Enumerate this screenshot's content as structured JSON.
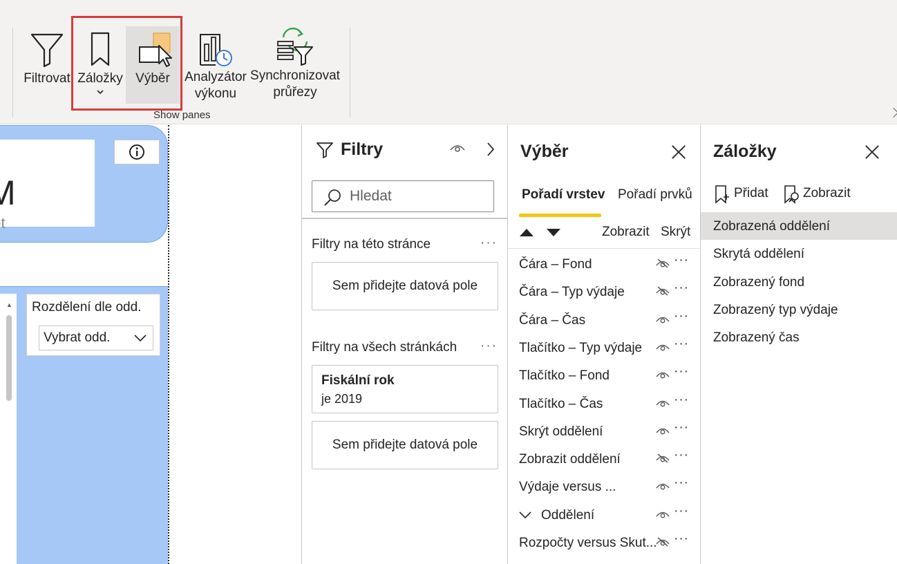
{
  "ribbon": {
    "buttons": [
      {
        "id": "filter",
        "label": "Filtrovat",
        "icon": "funnel-icon"
      },
      {
        "id": "bookmarks",
        "label": "Záložky",
        "icon": "bookmark-icon",
        "has_dropdown": true
      },
      {
        "id": "selection",
        "label": "Výběr",
        "icon": "selection-cursor-icon",
        "selected": true
      },
      {
        "id": "perf",
        "label_line1": "Analyzátor",
        "label_line2": "výkonu",
        "icon": "performance-analyzer-icon"
      },
      {
        "id": "sync",
        "label_line1": "Synchronizovat",
        "label_line2": "průřezy",
        "icon": "sync-slicers-icon"
      }
    ],
    "group_label": "Show panes",
    "highlight_color": "#d83b3b"
  },
  "canvas": {
    "kpi_value": "M",
    "kpi_subtitle": "get",
    "slicer_title": "Rozdělení dle odd.",
    "slicer_value": "Vybrat odd.",
    "accent_color": "#a6c8f6"
  },
  "filters": {
    "title": "Filtry",
    "search_placeholder": "Hledat",
    "page_section": "Filtry na této stránce",
    "page_well": "Sem přidejte datová pole",
    "all_section": "Filtry na všech stránkách",
    "card_title": "Fiskální rok",
    "card_value": "je 2019",
    "all_well": "Sem přidejte datová pole",
    "more": "···"
  },
  "selection": {
    "title": "Výběr",
    "tab_layers": "Pořadí vrstev",
    "tab_order": "Pořadí prvků",
    "show_all": "Zobrazit",
    "hide_all": "Skrýt",
    "tab_accent": "#f2c811",
    "items": [
      {
        "name": "Čára – Fond",
        "visible": false
      },
      {
        "name": "Čára – Typ výdaje",
        "visible": false
      },
      {
        "name": "Čára – Čas",
        "visible": true
      },
      {
        "name": "Tlačítko – Typ výdaje",
        "visible": true
      },
      {
        "name": "Tlačítko – Fond",
        "visible": true
      },
      {
        "name": "Tlačítko – Čas",
        "visible": true
      },
      {
        "name": "Skrýt oddělení",
        "visible": true
      },
      {
        "name": "Zobrazit oddělení",
        "visible": false
      },
      {
        "name": "Výdaje versus ...",
        "visible": true
      },
      {
        "name": "Oddělení",
        "visible": true,
        "group": true
      },
      {
        "name": "Rozpočty versus Skut...",
        "visible": false
      }
    ],
    "more": "···"
  },
  "bookmarks": {
    "title": "Záložky",
    "add": "Přidat",
    "view": "Zobrazit",
    "items": [
      {
        "name": "Zobrazená oddělení",
        "selected": true
      },
      {
        "name": "Skrytá oddělení"
      },
      {
        "name": "Zobrazený fond"
      },
      {
        "name": "Zobrazený typ výdaje"
      },
      {
        "name": "Zobrazený čas"
      }
    ]
  }
}
